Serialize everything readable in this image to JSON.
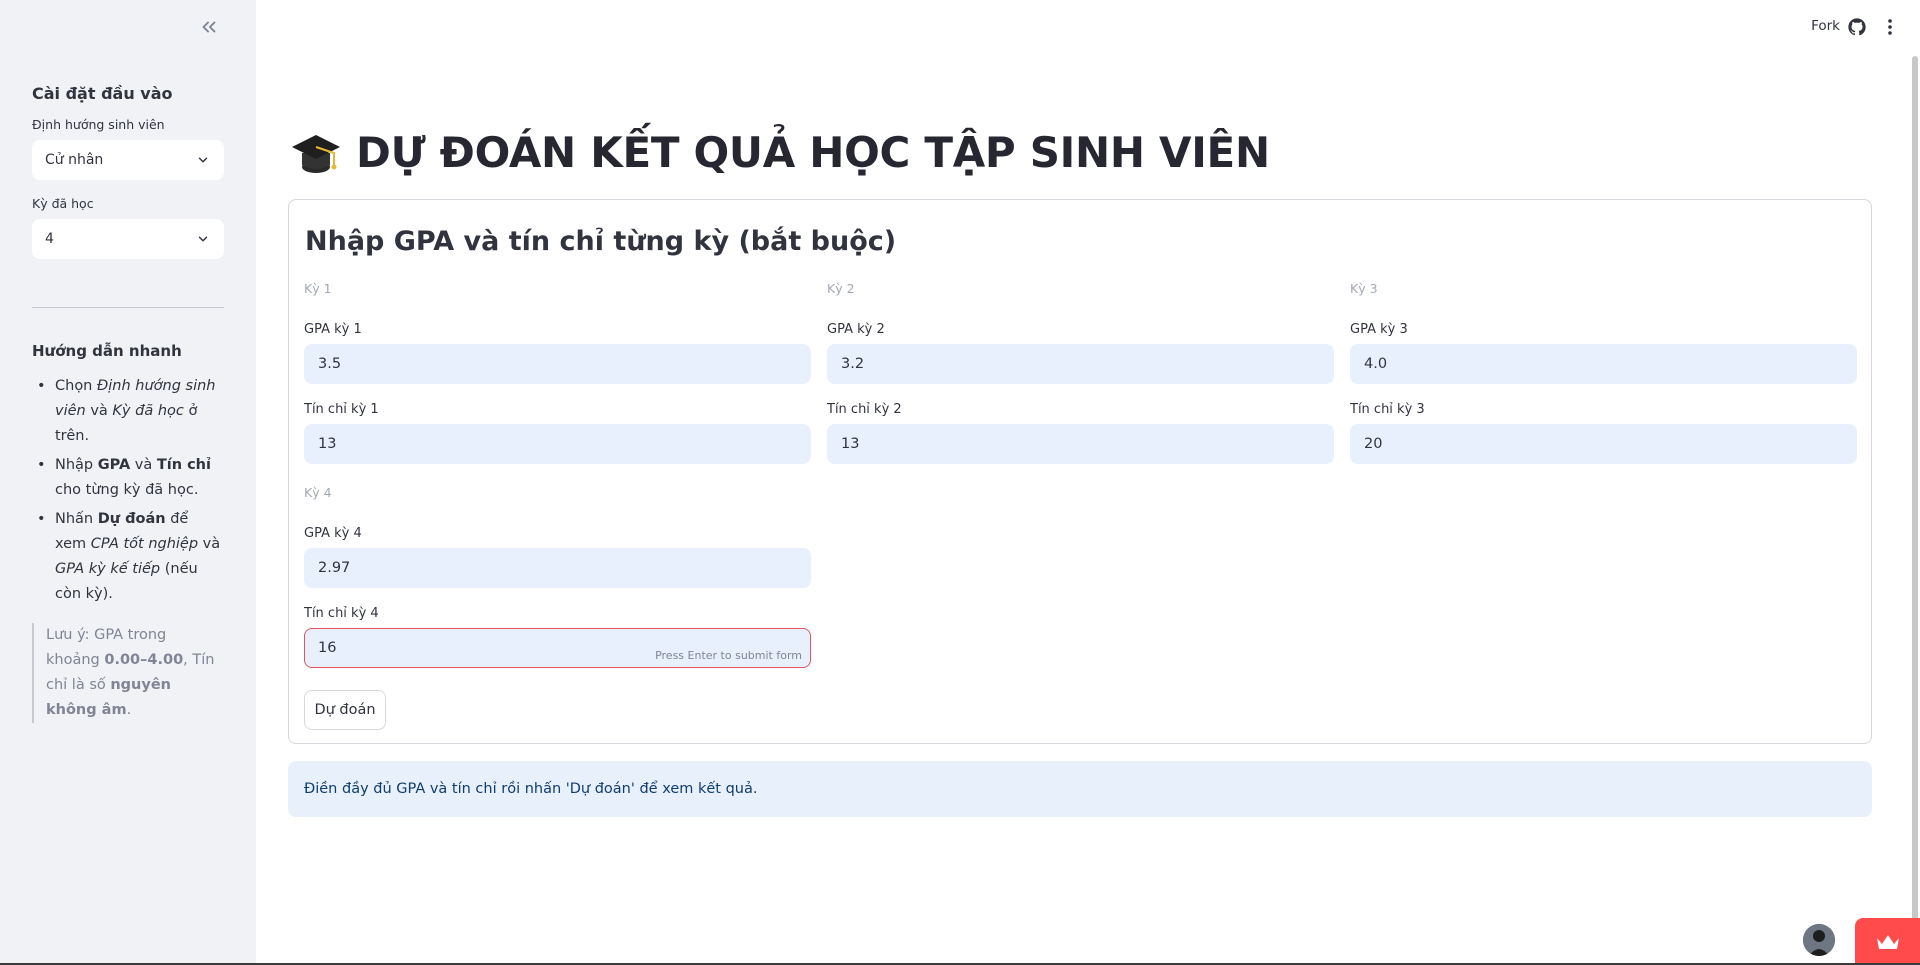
{
  "sidebar": {
    "header": "Cài đặt đầu vào",
    "orientation_label": "Định hướng sinh viên",
    "orientation_value": "Cử nhân",
    "terms_label": "Kỳ đã học",
    "terms_value": "4",
    "guide_title": "Hướng dẫn nhanh",
    "guide_items": [
      {
        "t1": "Chọn ",
        "em1": "Định hướng sinh viên",
        "t2": " và ",
        "em2": "Kỳ đã học",
        "t3": " ở trên."
      },
      {
        "t1": "Nhập ",
        "b1": "GPA",
        "t2": " và ",
        "b2": "Tín chỉ",
        "t3": " cho từng kỳ đã học."
      },
      {
        "t1": "Nhấn ",
        "b1": "Dự đoán",
        "t2": " để xem ",
        "em1": "CPA tốt nghiệp",
        "t3": " và ",
        "em2": "GPA kỳ kế tiếp",
        "t4": " (nếu còn kỳ)."
      }
    ],
    "note": {
      "t1": "Lưu ý: GPA trong khoảng ",
      "b1": "0.00–4.00",
      "t2": ", Tín chỉ là số ",
      "b2": "nguyên không âm",
      "t3": "."
    }
  },
  "header": {
    "fork_label": "Fork",
    "github_icon": "github-icon",
    "menu_icon": "kebab-menu-icon"
  },
  "main": {
    "title": "DỰ ĐOÁN KẾT QUẢ HỌC TẬP SINH VIÊN",
    "title_icon": "graduation-cap-icon",
    "form_heading": "Nhập GPA và tín chỉ từng kỳ (bắt buộc)",
    "terms": [
      {
        "term": "Kỳ 1",
        "gpa_label": "GPA kỳ 1",
        "gpa": "3.5",
        "credit_label": "Tín chỉ kỳ 1",
        "credit": "13"
      },
      {
        "term": "Kỳ 2",
        "gpa_label": "GPA kỳ 2",
        "gpa": "3.2",
        "credit_label": "Tín chỉ kỳ 2",
        "credit": "13"
      },
      {
        "term": "Kỳ 3",
        "gpa_label": "GPA kỳ 3",
        "gpa": "4.0",
        "credit_label": "Tín chỉ kỳ 3",
        "credit": "20"
      },
      {
        "term": "Kỳ 4",
        "gpa_label": "GPA kỳ 4",
        "gpa": "2.97",
        "credit_label": "Tín chỉ kỳ 4",
        "credit": "16"
      }
    ],
    "submit_hint": "Press Enter to submit form",
    "predict_button": "Dự đoán",
    "info_message": "Điền đầy đủ GPA và tín chỉ rồi nhấn 'Dự đoán' để xem kết quả."
  },
  "colors": {
    "accent": "#ff4b4b",
    "input_bg": "#e8f0fe",
    "info_bg": "#e8f1fb",
    "sidebar_bg": "#f0f2f6"
  }
}
